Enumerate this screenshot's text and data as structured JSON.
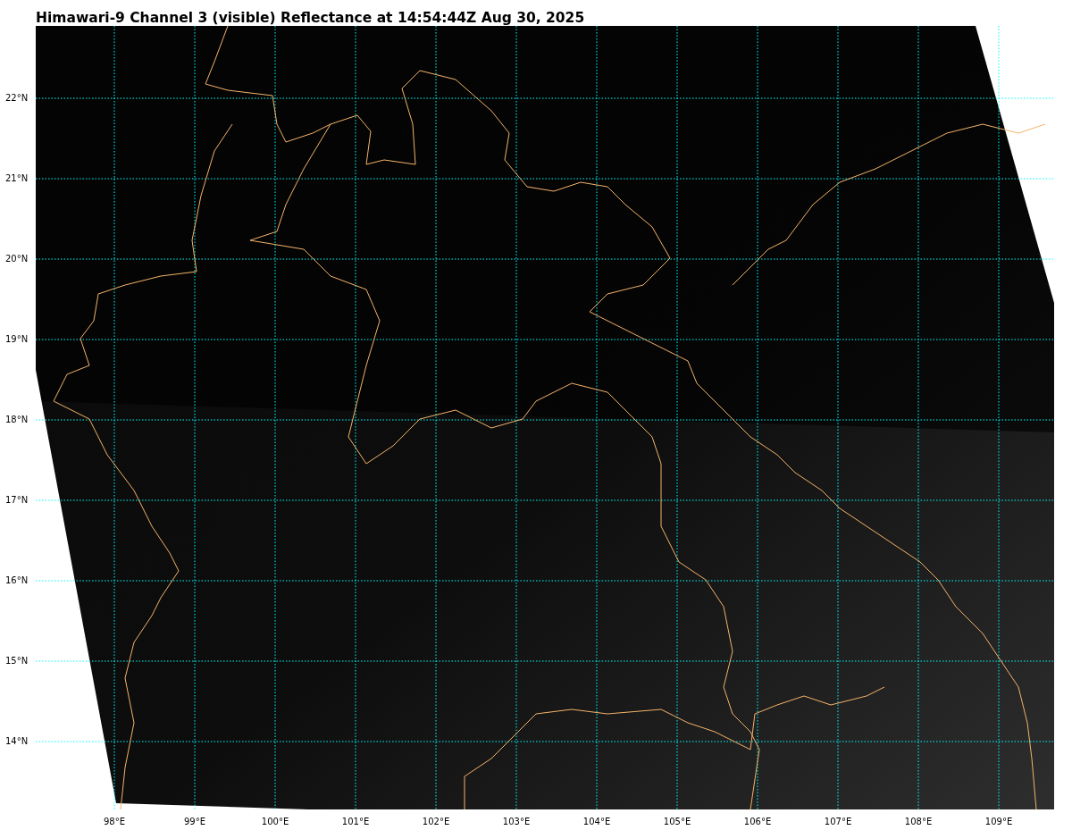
{
  "title": "Himawari-9 Channel 3 (visible) Reflectance at 14:54:44Z Aug 30, 2025",
  "map": {
    "longitude_labels": [
      "98°E",
      "99°E",
      "100°E",
      "101°E",
      "102°E",
      "103°E",
      "104°E",
      "105°E",
      "106°E",
      "107°E",
      "108°E",
      "109°E"
    ],
    "latitude_labels": [
      "22°N",
      "21°N",
      "20°N",
      "19°N",
      "18°N",
      "17°N",
      "16°N",
      "15°N",
      "14°N"
    ]
  }
}
